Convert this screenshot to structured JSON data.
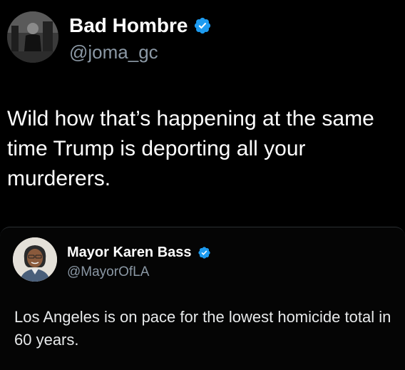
{
  "colors": {
    "background": "#000000",
    "verified_badge": "#1d9bf0",
    "handle_text": "#8b98a5"
  },
  "tweet": {
    "author_name": "Bad Hombre",
    "author_handle": "@joma_gc",
    "verified_icon": "verified-badge",
    "text": "Wild how that’s happening at the same time Trump is deporting all your murderers."
  },
  "quoted_tweet": {
    "author_name": "Mayor Karen Bass",
    "author_handle": "@MayorOfLA",
    "verified_icon": "verified-badge",
    "text": "Los Angeles is on pace for the lowest homicide total in 60 years."
  }
}
